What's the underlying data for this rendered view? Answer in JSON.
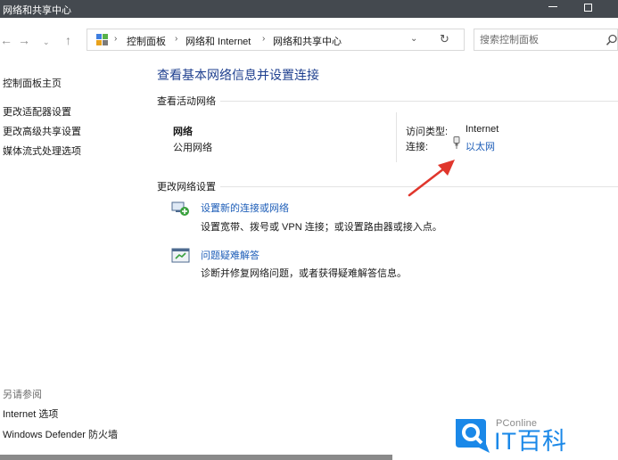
{
  "window": {
    "title": "网络和共享中心"
  },
  "nav": {
    "back": "←",
    "forward": "→",
    "recent": "⌄",
    "up": "↑"
  },
  "address": {
    "separator": "›",
    "crumbs": [
      "控制面板",
      "网络和 Internet",
      "网络和共享中心"
    ],
    "dropdown": "⌄",
    "refresh": "↻"
  },
  "search": {
    "placeholder": "搜索控制面板"
  },
  "sidebar": {
    "items": [
      "控制面板主页",
      "更改适配器设置",
      "更改高级共享设置",
      "媒体流式处理选项"
    ],
    "see_also_title": "另请参阅",
    "see_also": [
      "Internet 选项",
      "Windows Defender 防火墙"
    ]
  },
  "main": {
    "heading": "查看基本网络信息并设置连接",
    "active_title": "查看活动网络",
    "network": {
      "name": "网络",
      "type": "公用网络",
      "access_label": "访问类型:",
      "access_value": "Internet",
      "connection_label": "连接:",
      "connection_value": "以太网"
    },
    "change_title": "更改网络设置",
    "tasks": [
      {
        "link": "设置新的连接或网络",
        "desc": "设置宽带、拨号或 VPN 连接；或设置路由器或接入点。"
      },
      {
        "link": "问题疑难解答",
        "desc": "诊断并修复网络问题，或者获得疑难解答信息。"
      }
    ]
  },
  "watermark": {
    "small": "PConline",
    "big": "IT百科"
  },
  "colors": {
    "titlebar": "#44494f",
    "heading": "#1e3f8f",
    "link": "#1e5eb8",
    "arrow": "#e0362c",
    "watermark": "#1a88e8"
  }
}
